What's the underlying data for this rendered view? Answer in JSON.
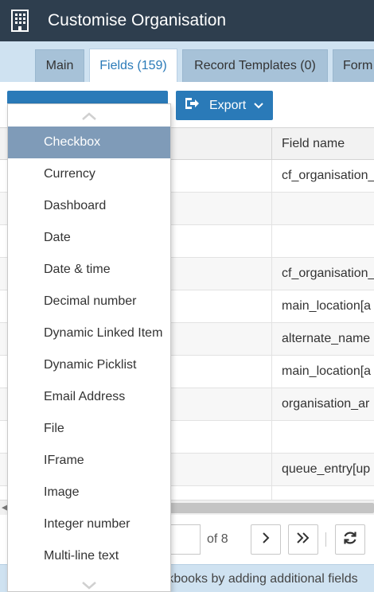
{
  "header": {
    "title": "Customise Organisation",
    "icon": "building-icon"
  },
  "tabs": [
    {
      "label": "Main"
    },
    {
      "label": "Fields (159)"
    },
    {
      "label": "Record Templates (0)"
    },
    {
      "label": "Form"
    }
  ],
  "toolbar": {
    "export_label": "Export"
  },
  "table": {
    "field_name_header": "Field name",
    "rows": [
      {
        "field": "cf_organisation_"
      },
      {
        "field": ""
      },
      {
        "field": ""
      },
      {
        "field": "cf_organisation_"
      },
      {
        "field": "main_location[a"
      },
      {
        "field": "alternate_name"
      },
      {
        "field": "main_location[a"
      },
      {
        "field": "organisation_ar"
      },
      {
        "field": ""
      },
      {
        "field": "queue_entry[up"
      },
      {
        "field": ""
      }
    ]
  },
  "pager": {
    "page_value": "",
    "of_label": "of 8"
  },
  "footer": {
    "text": "rkbooks by adding additional fields"
  },
  "dropdown": {
    "items": [
      {
        "label": "Checkbox",
        "selected": true
      },
      {
        "label": "Currency"
      },
      {
        "label": "Dashboard"
      },
      {
        "label": "Date"
      },
      {
        "label": "Date & time"
      },
      {
        "label": "Decimal number"
      },
      {
        "label": "Dynamic Linked Item"
      },
      {
        "label": "Dynamic Picklist"
      },
      {
        "label": "Email Address"
      },
      {
        "label": "File"
      },
      {
        "label": "IFrame"
      },
      {
        "label": "Image"
      },
      {
        "label": "Integer number"
      },
      {
        "label": "Multi-line text"
      }
    ]
  },
  "colors": {
    "header_bg": "#2e3e4e",
    "tabbar_bg": "#cfe2f1",
    "accent": "#2a7ab8",
    "selected_item": "#7f9bb8"
  }
}
